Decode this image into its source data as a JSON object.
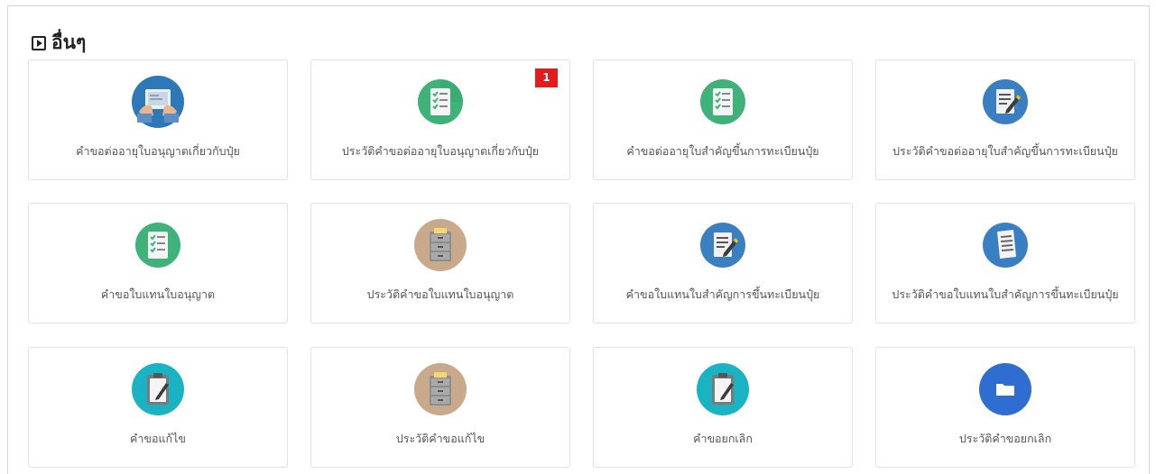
{
  "section": {
    "title": "อื่นๆ",
    "icon": "play-square-icon"
  },
  "cards": [
    {
      "label": "คำขอต่ออายุใบอนุญาตเกี่ยวกับปุ๋ย",
      "icon": "tablet-hands-icon"
    },
    {
      "label": "ประวัติคำขอต่ออายุใบอนุญาตเกี่ยวกับปุ๋ย",
      "icon": "green-checklist-icon",
      "badge": "1"
    },
    {
      "label": "คำขอต่ออายุใบสำคัญขึ้นการทะเบียนปุ๋ย",
      "icon": "green-checklist-icon"
    },
    {
      "label": "ประวัติคำขอต่ออายุใบสำคัญขึ้นการทะเบียนปุ๋ย",
      "icon": "blue-document-edit-icon"
    },
    {
      "label": "คำขอใบแทนใบอนุญาต",
      "icon": "green-checklist-icon"
    },
    {
      "label": "ประวัติคำขอใบแทนใบอนุญาต",
      "icon": "filing-cabinet-icon"
    },
    {
      "label": "คำขอใบแทนใบสำคัญการขึ้นทะเบียนปุ๋ย",
      "icon": "blue-document-edit-icon"
    },
    {
      "label": "ประวัติคำขอใบแทนใบสำคัญการขึ้นทะเบียนปุ๋ย",
      "icon": "blue-document-list-icon"
    },
    {
      "label": "คำขอแก้ไข",
      "icon": "teal-clipboard-edit-icon"
    },
    {
      "label": "ประวัติคำขอแก้ไข",
      "icon": "filing-cabinet-icon"
    },
    {
      "label": "คำขอยกเลิก",
      "icon": "teal-clipboard-edit-icon"
    },
    {
      "label": "ประวัติคำขอยกเลิก",
      "icon": "folder-icon"
    }
  ],
  "colors": {
    "badge": "#e41c1c",
    "green_icon": "#3fb27a",
    "blue_icon": "#3a7fc1",
    "teal_icon": "#1ab3c4",
    "tan_icon": "#c8a98c",
    "folder_blue": "#2f6ed0"
  }
}
